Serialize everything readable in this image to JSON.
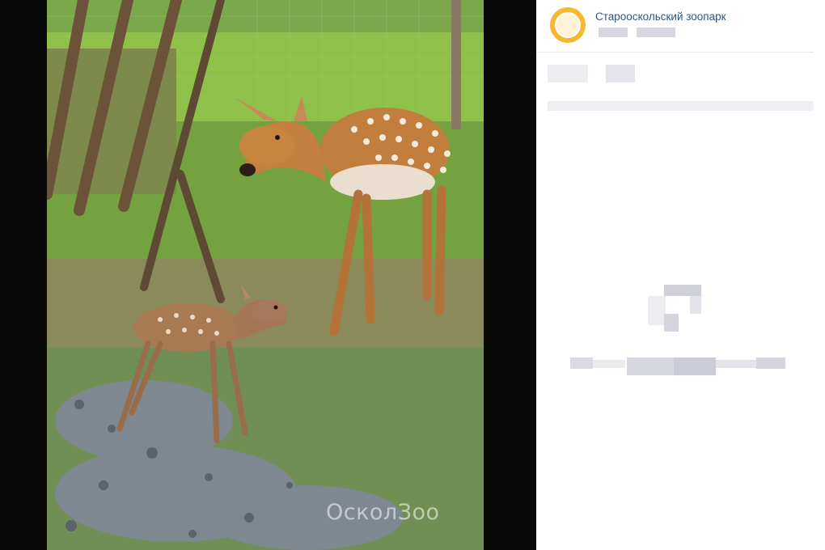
{
  "post": {
    "author": "Старооскольский зоопарк",
    "photo_watermark": "ОсколЗоо"
  },
  "icons": {
    "avatar": "zoo-logo-icon"
  },
  "colors": {
    "viewer_background": "#0a0a0a",
    "panel_background": "#ffffff",
    "author_link": "#2a5885",
    "avatar_ring": "#f5b82e"
  }
}
